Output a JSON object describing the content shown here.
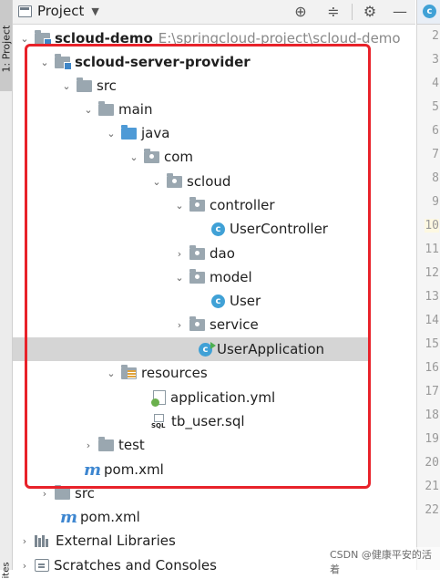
{
  "panel": {
    "title": "Project",
    "side_tab_label": "1: Project",
    "side_bottom_label": "ites"
  },
  "header_icons": [
    "target-icon",
    "collapse-icon",
    "gear-icon",
    "minimize-icon"
  ],
  "editor": {
    "line_numbers": [
      "2",
      "3",
      "4",
      "5",
      "6",
      "7",
      "8",
      "9",
      "10",
      "11",
      "12",
      "13",
      "14",
      "15",
      "16",
      "17",
      "18",
      "19",
      "20",
      "21",
      "22"
    ],
    "highlighted_line": "10"
  },
  "tree": {
    "root": {
      "label": "scloud-demo",
      "path": "E:\\springcloud-project\\scloud-demo"
    },
    "provider": "scloud-server-provider",
    "src": "src",
    "main": "main",
    "java": "java",
    "com": "com",
    "scloud": "scloud",
    "controller": "controller",
    "user_controller": "UserController",
    "dao": "dao",
    "model": "model",
    "user": "User",
    "service": "service",
    "user_application": "UserApplication",
    "resources": "resources",
    "application_yml": "application.yml",
    "tb_user_sql": "tb_user.sql",
    "test": "test",
    "provider_pom": "pom.xml",
    "root_src": "src",
    "root_pom": "pom.xml",
    "external_libraries": "External Libraries",
    "scratches": "Scratches and Consoles"
  },
  "watermark": "CSDN @健康平安的活着",
  "colors": {
    "annotation": "#e8222a",
    "selection": "#d5d5d5",
    "source_folder": "#4e9ad6",
    "class_icon": "#40a1d6"
  }
}
